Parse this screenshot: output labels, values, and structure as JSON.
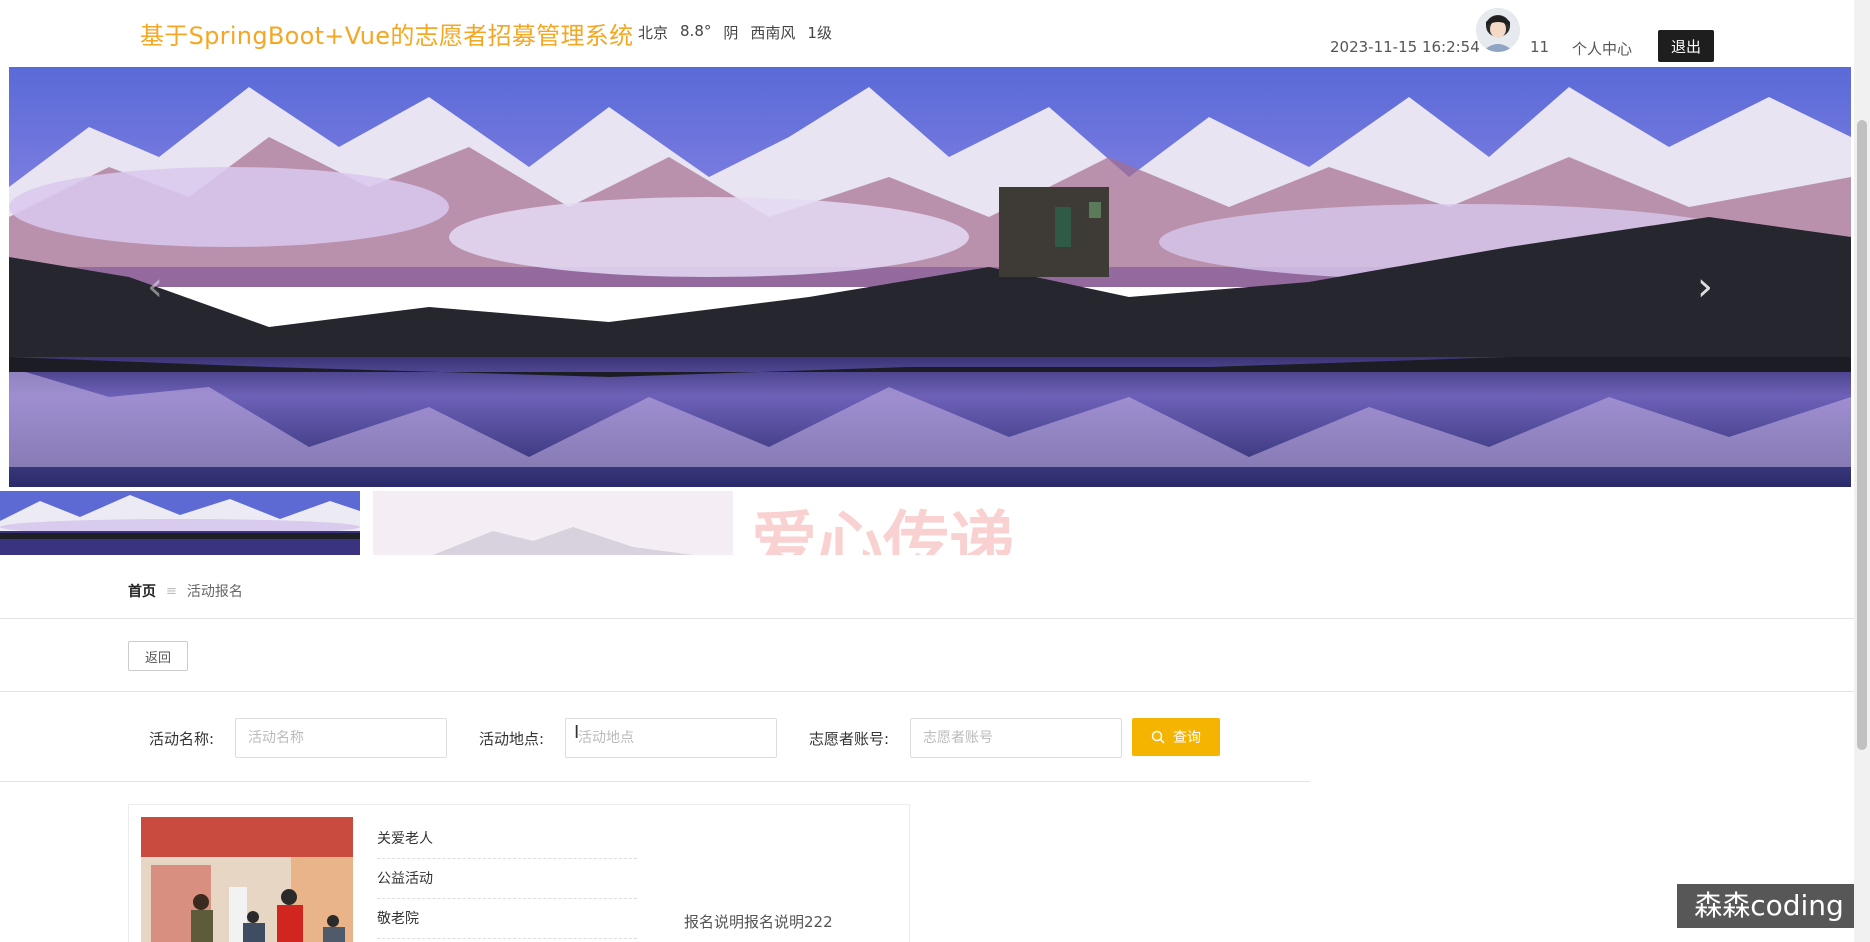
{
  "header": {
    "site_title": "基于SpringBoot+Vue的志愿者招募管理系统",
    "weather": {
      "city": "北京",
      "temp": "8.8°",
      "condition": "阴",
      "wind": "西南风",
      "level": "1级"
    },
    "datetime": "2023-11-15 16:2:54",
    "username": "11",
    "center_link": "个人中心",
    "logout_label": "退出"
  },
  "carousel": {
    "prev_icon": "chevron-left-icon",
    "next_icon": "chevron-right-icon",
    "prev_glyph": "‹",
    "next_glyph": "›",
    "thumb3_text": "爱心传递"
  },
  "breadcrumb": {
    "home": "首页",
    "separator": "≡",
    "current": "活动报名"
  },
  "back_label": "返回",
  "search": {
    "name_label": "活动名称:",
    "name_placeholder": "活动名称",
    "place_label": "活动地点:",
    "place_placeholder": "活动地点",
    "account_label": "志愿者账号:",
    "account_placeholder": "志愿者账号",
    "query_label": "查询"
  },
  "card": {
    "fields": [
      "关爱老人",
      "公益活动",
      "敬老院"
    ],
    "description": "报名说明报名说明222"
  },
  "watermark": "森森coding",
  "colors": {
    "title": "#f5a623",
    "query": "#f5b400",
    "logout": "#1e1e1e"
  }
}
